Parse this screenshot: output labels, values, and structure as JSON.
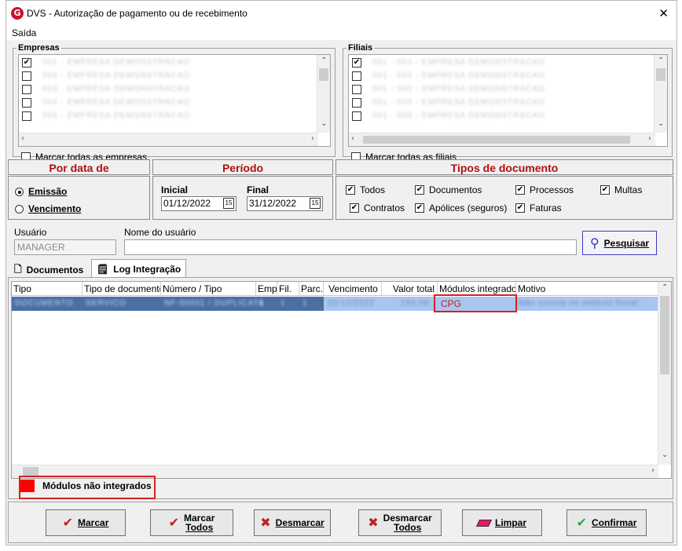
{
  "window": {
    "title": "DVS - Autorização de pagamento ou de recebimento",
    "app_icon": "G"
  },
  "menu": {
    "item": "Saída"
  },
  "empresas": {
    "legend": "Empresas",
    "rows": [
      {
        "checked": true,
        "text": "001 - EMPRESA DEMONSTRACAO"
      },
      {
        "checked": false,
        "text": "002 - EMPRESA DEMONSTRACAO"
      },
      {
        "checked": false,
        "text": "003 - EMPRESA DEMONSTRACAO"
      },
      {
        "checked": false,
        "text": "004 - EMPRESA DEMONSTRACAO"
      },
      {
        "checked": false,
        "text": "005 - EMPRESA DEMONSTRACAO"
      }
    ],
    "select_all": "Marcar todas as empresas"
  },
  "filiais": {
    "legend": "Filiais",
    "rows": [
      {
        "checked": true,
        "text": "001 - 001 - EMPRESA DEMONSTRACAO"
      },
      {
        "checked": false,
        "text": "001 - 002 - EMPRESA DEMONSTRACAO"
      },
      {
        "checked": false,
        "text": "001 - 003 - EMPRESA DEMONSTRACAO"
      },
      {
        "checked": false,
        "text": "001 - 004 - EMPRESA DEMONSTRACAO"
      },
      {
        "checked": false,
        "text": "001 - 005 - EMPRESA DEMONSTRACAO"
      }
    ],
    "select_all": "Marcar todas as filiais"
  },
  "por_data": {
    "header": "Por data de",
    "emissao": "Emissão",
    "vencimento": "Vencimento",
    "selected": "emissao"
  },
  "periodo": {
    "header": "Período",
    "inicial_label": "Inicial",
    "inicial_value": "01/12/2022",
    "final_label": "Final",
    "final_value": "31/12/2022",
    "cal_icon": "15"
  },
  "tipos": {
    "header": "Tipos de documento",
    "todos": "Todos",
    "contratos": "Contratos",
    "documentos": "Documentos",
    "apolices": "Apólices (seguros)",
    "processos": "Processos",
    "faturas": "Faturas",
    "multas": "Multas"
  },
  "usuario": {
    "label": "Usuário",
    "value": "MANAGER",
    "nome_label": "Nome do usuário",
    "nome_value": "",
    "search_button": "Pesquisar"
  },
  "tabs": {
    "documentos": "Documentos",
    "log": "Log Integração"
  },
  "grid": {
    "headers": [
      "Tipo",
      "Tipo de documento",
      "Número / Tipo",
      "Emp.",
      "Fil.",
      "Parc.",
      "Vencimento",
      "Valor total",
      "Módulos integrados",
      "Motivo"
    ],
    "row": [
      "DOCUMENTO",
      "SERVICO",
      "NF-00001 / DUPLICATA",
      "1",
      "1",
      "1",
      "20/12/2022",
      "150,00",
      "CPG",
      "Não consta no módulo fiscal"
    ]
  },
  "legend_bar": {
    "label": "Módulos não integrados",
    "color": "#ff0000"
  },
  "buttons": {
    "marcar": "Marcar",
    "marcar_todos_1": "Marcar",
    "marcar_todos_2": "Todos",
    "desmarcar": "Desmarcar",
    "desmarcar_todos_1": "Desmarcar",
    "desmarcar_todos_2": "Todos",
    "limpar": "Limpar",
    "confirmar": "Confirmar"
  },
  "colors": {
    "header_red": "#b01010",
    "highlight": "#d92020",
    "selection": "#a9c6ef"
  }
}
